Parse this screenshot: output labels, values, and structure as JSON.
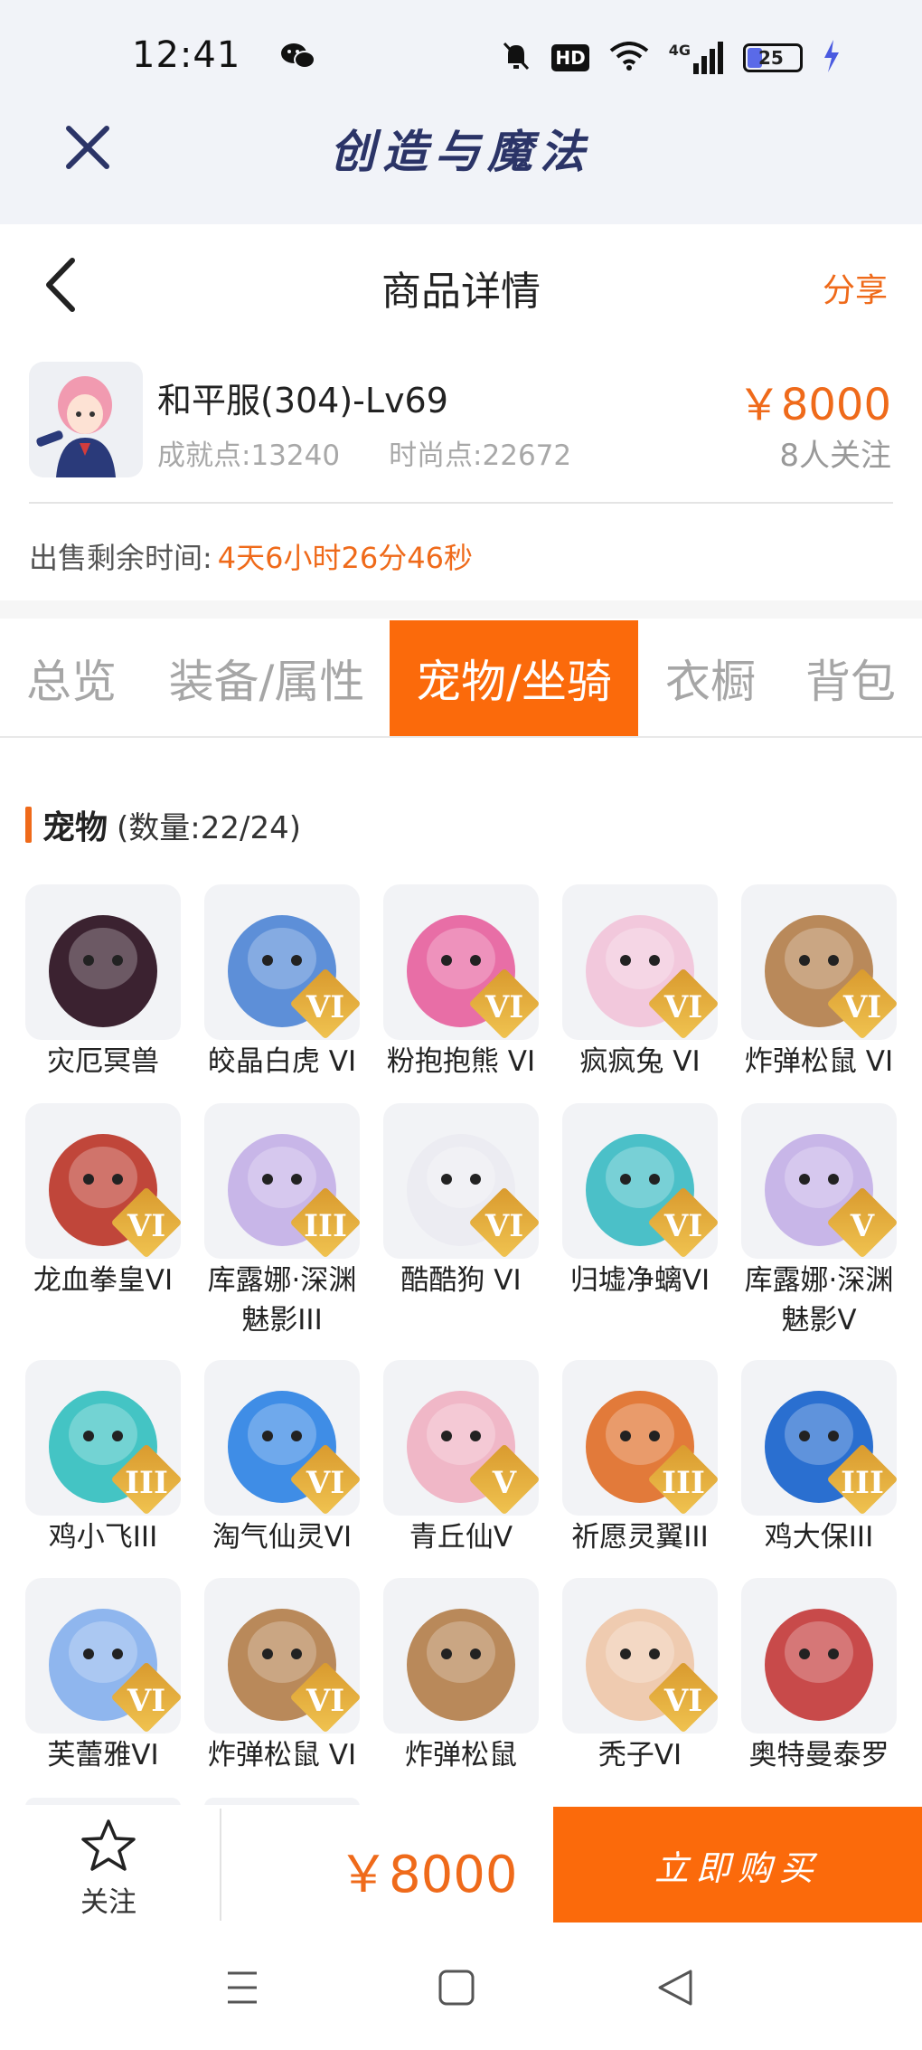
{
  "status": {
    "time": "12:41",
    "battery": "25",
    "signal_label": "4G",
    "hd_label": "HD"
  },
  "app": {
    "title": "创造与魔法"
  },
  "header": {
    "title": "商品详情",
    "share": "分享"
  },
  "product": {
    "server": "和平服(304)-Lv69",
    "achievement": "成就点:13240",
    "fashion": "时尚点:22672",
    "price": "￥8000",
    "followers": "8人关注",
    "remaining_label": "出售剩余时间:",
    "remaining_time": "4天6小时26分46秒"
  },
  "tabs": [
    "总览",
    "装备/属性",
    "宠物/坐骑",
    "衣橱",
    "背包"
  ],
  "active_tab": "宠物/坐骑",
  "section": {
    "title": "宠物",
    "count": "(数量:22/24)"
  },
  "pets": [
    {
      "name": "灾厄冥兽",
      "badge": "",
      "color": "#3b2230"
    },
    {
      "name": "皎晶白虎 VI",
      "badge": "VI",
      "color": "#5d8fd8"
    },
    {
      "name": "粉抱抱熊 VI",
      "badge": "VI",
      "color": "#e86ea6"
    },
    {
      "name": "疯疯兔 VI",
      "badge": "VI",
      "color": "#f2c8dc"
    },
    {
      "name": "炸弹松鼠 VI",
      "badge": "VI",
      "color": "#b9895a"
    },
    {
      "name": "龙血拳皇VI",
      "badge": "VI",
      "color": "#c0463a"
    },
    {
      "name": "库露娜·深渊魅影III",
      "badge": "III",
      "color": "#c8b6e8"
    },
    {
      "name": "酷酷狗 VI",
      "badge": "VI",
      "color": "#ececf2"
    },
    {
      "name": "归墟净螭VI",
      "badge": "VI",
      "color": "#4bc0c8"
    },
    {
      "name": "库露娜·深渊魅影V",
      "badge": "V",
      "color": "#c8b6e8"
    },
    {
      "name": "鸡小飞III",
      "badge": "III",
      "color": "#44c4c4"
    },
    {
      "name": "淘气仙灵VI",
      "badge": "VI",
      "color": "#3f8de6"
    },
    {
      "name": "青丘仙V",
      "badge": "V",
      "color": "#f0b7c7"
    },
    {
      "name": "祈愿灵翼III",
      "badge": "III",
      "color": "#e27a3a"
    },
    {
      "name": "鸡大保III",
      "badge": "III",
      "color": "#2a6fd0"
    },
    {
      "name": "芙蕾雅VI",
      "badge": "VI",
      "color": "#8fb6ee"
    },
    {
      "name": "炸弹松鼠 VI",
      "badge": "VI",
      "color": "#b9895a"
    },
    {
      "name": "炸弹松鼠",
      "badge": "",
      "color": "#b9895a"
    },
    {
      "name": "秃子VI",
      "badge": "VI",
      "color": "#efcbb0"
    },
    {
      "name": "奥特曼泰罗",
      "badge": "",
      "color": "#c84a4a"
    }
  ],
  "bottom": {
    "follow": "关注",
    "price": "￥8000",
    "buy": "立即购买"
  },
  "colors": {
    "accent": "#fb6a0b",
    "title": "#2b3467"
  }
}
